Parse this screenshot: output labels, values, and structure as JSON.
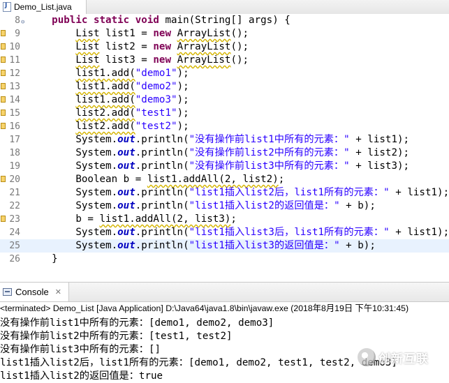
{
  "editor": {
    "tab_label": "Demo_List.java",
    "lines": [
      {
        "n": "8",
        "marker": false,
        "fold": true,
        "current": false,
        "segs": [
          [
            "",
            "    "
          ],
          [
            "kw",
            "public static void"
          ],
          [
            "",
            " main(String[] args) {"
          ]
        ]
      },
      {
        "n": "9",
        "marker": true,
        "fold": false,
        "current": false,
        "segs": [
          [
            "",
            "        "
          ],
          [
            "warn",
            "List"
          ],
          [
            "",
            " list1 = "
          ],
          [
            "kw",
            "new"
          ],
          [
            "",
            " "
          ],
          [
            "warn",
            "ArrayList"
          ],
          [
            "",
            "();"
          ]
        ]
      },
      {
        "n": "10",
        "marker": true,
        "fold": false,
        "current": false,
        "segs": [
          [
            "",
            "        "
          ],
          [
            "warn",
            "List"
          ],
          [
            "",
            " list2 = "
          ],
          [
            "kw",
            "new"
          ],
          [
            "",
            " "
          ],
          [
            "warn",
            "ArrayList"
          ],
          [
            "",
            "();"
          ]
        ]
      },
      {
        "n": "11",
        "marker": true,
        "fold": false,
        "current": false,
        "segs": [
          [
            "",
            "        "
          ],
          [
            "warn",
            "List"
          ],
          [
            "",
            " list3 = "
          ],
          [
            "kw",
            "new"
          ],
          [
            "",
            " "
          ],
          [
            "warn",
            "ArrayList"
          ],
          [
            "",
            "();"
          ]
        ]
      },
      {
        "n": "12",
        "marker": true,
        "fold": false,
        "current": false,
        "segs": [
          [
            "",
            "        "
          ],
          [
            "warn",
            "list1.add("
          ],
          [
            "str",
            "\"demo1\""
          ],
          [
            "",
            ");"
          ]
        ]
      },
      {
        "n": "13",
        "marker": true,
        "fold": false,
        "current": false,
        "segs": [
          [
            "",
            "        "
          ],
          [
            "warn",
            "list1.add("
          ],
          [
            "str",
            "\"demo2\""
          ],
          [
            "",
            ");"
          ]
        ]
      },
      {
        "n": "14",
        "marker": true,
        "fold": false,
        "current": false,
        "segs": [
          [
            "",
            "        "
          ],
          [
            "warn",
            "list1.add("
          ],
          [
            "str",
            "\"demo3\""
          ],
          [
            "",
            ");"
          ]
        ]
      },
      {
        "n": "15",
        "marker": true,
        "fold": false,
        "current": false,
        "segs": [
          [
            "",
            "        "
          ],
          [
            "warn",
            "list2.add("
          ],
          [
            "str",
            "\"test1\""
          ],
          [
            "",
            ");"
          ]
        ]
      },
      {
        "n": "16",
        "marker": true,
        "fold": false,
        "current": false,
        "segs": [
          [
            "",
            "        "
          ],
          [
            "warn",
            "list2.add("
          ],
          [
            "str",
            "\"test2\""
          ],
          [
            "",
            ");"
          ]
        ]
      },
      {
        "n": "17",
        "marker": false,
        "fold": false,
        "current": false,
        "segs": [
          [
            "",
            "        System."
          ],
          [
            "fld",
            "out"
          ],
          [
            "",
            ".println("
          ],
          [
            "str",
            "\"没有操作前list1中所有的元素：\""
          ],
          [
            "",
            " + list1);"
          ]
        ]
      },
      {
        "n": "18",
        "marker": false,
        "fold": false,
        "current": false,
        "segs": [
          [
            "",
            "        System."
          ],
          [
            "fld",
            "out"
          ],
          [
            "",
            ".println("
          ],
          [
            "str",
            "\"没有操作前list2中所有的元素：\""
          ],
          [
            "",
            " + list2);"
          ]
        ]
      },
      {
        "n": "19",
        "marker": false,
        "fold": false,
        "current": false,
        "segs": [
          [
            "",
            "        System."
          ],
          [
            "fld",
            "out"
          ],
          [
            "",
            ".println("
          ],
          [
            "str",
            "\"没有操作前list3中所有的元素：\""
          ],
          [
            "",
            " + list3);"
          ]
        ]
      },
      {
        "n": "20",
        "marker": true,
        "fold": false,
        "current": false,
        "segs": [
          [
            "",
            "        Boolean b = "
          ],
          [
            "warn",
            "list1.addAll(2, list2)"
          ],
          [
            "",
            ";"
          ]
        ]
      },
      {
        "n": "21",
        "marker": false,
        "fold": false,
        "current": false,
        "segs": [
          [
            "",
            "        System."
          ],
          [
            "fld",
            "out"
          ],
          [
            "",
            ".println("
          ],
          [
            "str",
            "\"list1插入list2后，list1所有的元素：\""
          ],
          [
            "",
            " + list1);"
          ]
        ]
      },
      {
        "n": "22",
        "marker": false,
        "fold": false,
        "current": false,
        "segs": [
          [
            "",
            "        System."
          ],
          [
            "fld",
            "out"
          ],
          [
            "",
            ".println("
          ],
          [
            "str",
            "\"list1插入list2的返回值是：\""
          ],
          [
            "",
            " + b);"
          ]
        ]
      },
      {
        "n": "23",
        "marker": true,
        "fold": false,
        "current": false,
        "segs": [
          [
            "",
            "        b = "
          ],
          [
            "warn",
            "list1.addAll(2, list3)"
          ],
          [
            "",
            ";"
          ]
        ]
      },
      {
        "n": "24",
        "marker": false,
        "fold": false,
        "current": false,
        "segs": [
          [
            "",
            "        System."
          ],
          [
            "fld",
            "out"
          ],
          [
            "",
            ".println("
          ],
          [
            "str",
            "\"list1插入list3后，list1所有的元素：\""
          ],
          [
            "",
            " + list1);"
          ]
        ]
      },
      {
        "n": "25",
        "marker": false,
        "fold": false,
        "current": true,
        "segs": [
          [
            "",
            "        System."
          ],
          [
            "fld",
            "out"
          ],
          [
            "",
            ".println("
          ],
          [
            "str",
            "\"list1插入list3的返回值是：\""
          ],
          [
            "",
            " + b);"
          ]
        ]
      },
      {
        "n": "26",
        "marker": false,
        "fold": false,
        "current": false,
        "segs": [
          [
            "",
            "    }"
          ]
        ]
      }
    ]
  },
  "console": {
    "tab_label": "Console",
    "close_glyph": "✕",
    "status": "<terminated> Demo_List [Java Application] D:\\Java64\\java1.8\\bin\\javaw.exe (2018年8月19日 下午10:31:45)",
    "output": [
      "没有操作前list1中所有的元素：[demo1, demo2, demo3]",
      "没有操作前list2中所有的元素：[test1, test2]",
      "没有操作前list3中所有的元素：[]",
      "list1插入list2后，list1所有的元素：[demo1, demo2, test1, test2, demo3]",
      "list1插入list2的返回值是：true"
    ]
  },
  "watermark": {
    "text": "创新互联"
  },
  "icons": {
    "file": "java-file-icon",
    "console": "console-icon",
    "marker": "warning-marker-icon",
    "fold": "fold-collapse-icon"
  }
}
